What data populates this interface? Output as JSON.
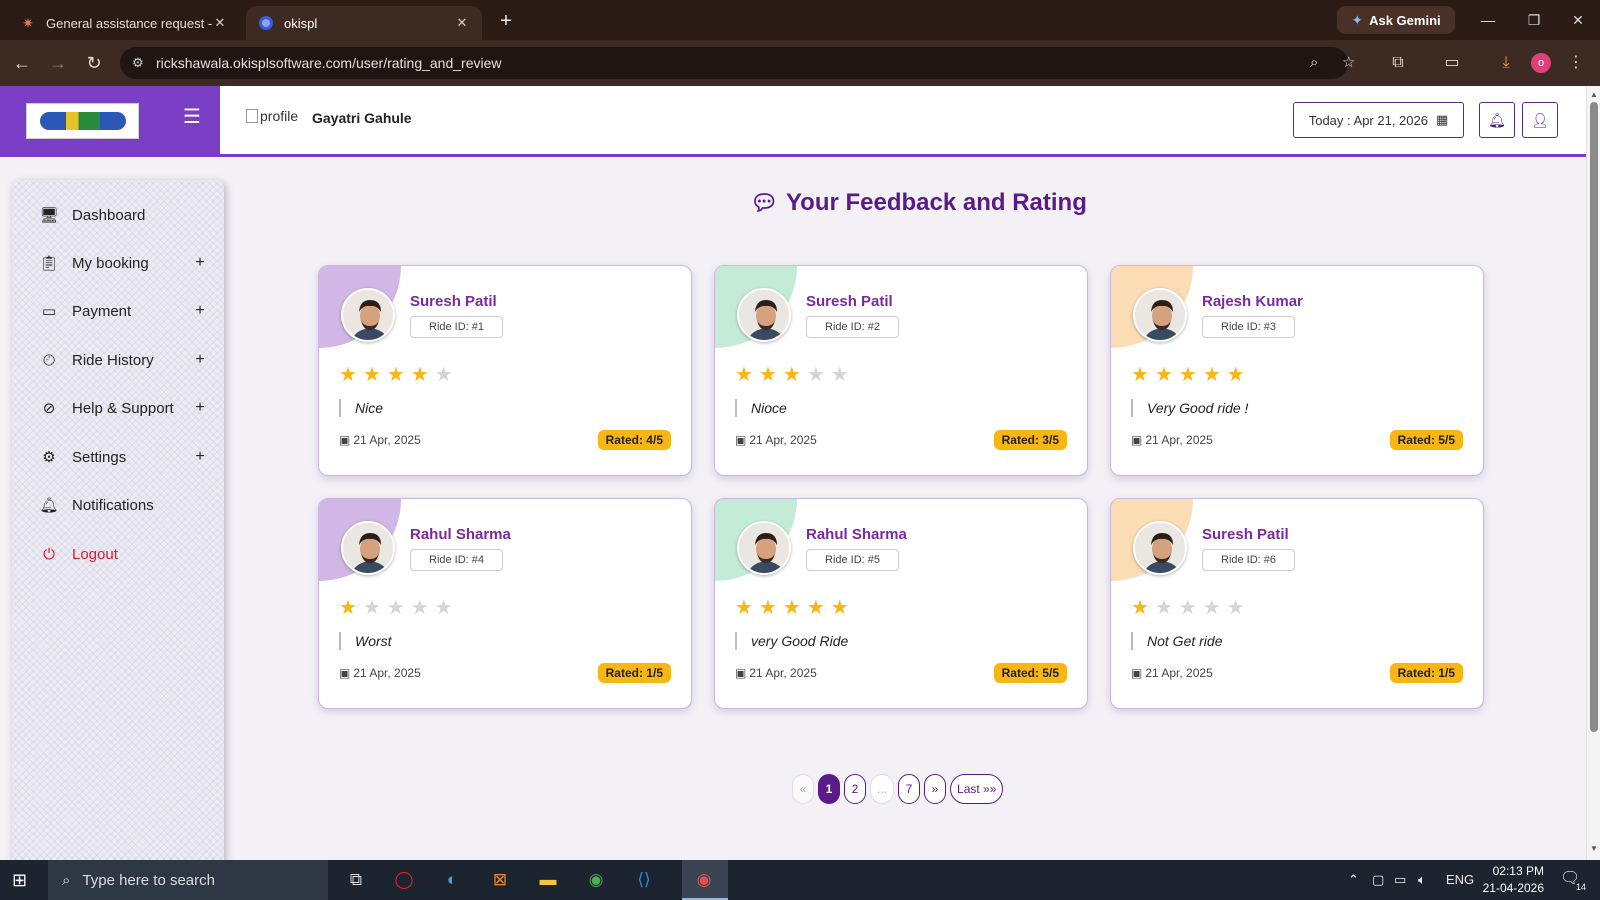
{
  "browser": {
    "tabs": [
      {
        "title": "General assistance request - Cla",
        "icon": "claude-star-icon"
      },
      {
        "title": "okispl",
        "icon": "globe-icon"
      }
    ],
    "gemini_label": "Ask Gemini",
    "url": "rickshawala.okisplsoftware.com/user/rating_and_review",
    "profile_initial": "o"
  },
  "header": {
    "profile_alt": "profile",
    "user_name": "Gayatri Gahule",
    "today_label": "Today : Apr 21, 2026"
  },
  "sidebar": {
    "items": [
      {
        "label": "Dashboard",
        "icon": "monitor-icon",
        "expandable": false
      },
      {
        "label": "My booking",
        "icon": "clipboard-icon",
        "expandable": true
      },
      {
        "label": "Payment",
        "icon": "credit-card-icon",
        "expandable": true
      },
      {
        "label": "Ride History",
        "icon": "clock-icon",
        "expandable": true
      },
      {
        "label": "Help & Support",
        "icon": "compass-icon",
        "expandable": true
      },
      {
        "label": "Settings",
        "icon": "gear-icon",
        "expandable": true
      },
      {
        "label": "Notifications",
        "icon": "bell-icon",
        "expandable": false
      },
      {
        "label": "Logout",
        "icon": "power-icon",
        "expandable": false
      }
    ],
    "plus_symbol": "+"
  },
  "main": {
    "title": "Your Feedback and Rating",
    "reviews": [
      {
        "name": "Suresh Patil",
        "ride_id": "Ride ID: #1",
        "stars": 4,
        "comment": "Nice",
        "date": "21 Apr, 2025",
        "rated": "Rated: 4/5",
        "accent": "#d2b6e6"
      },
      {
        "name": "Suresh Patil",
        "ride_id": "Ride ID: #2",
        "stars": 3,
        "comment": "Nioce",
        "date": "21 Apr, 2025",
        "rated": "Rated: 3/5",
        "accent": "#c4ebd6"
      },
      {
        "name": "Rajesh Kumar",
        "ride_id": "Ride ID: #3",
        "stars": 5,
        "comment": "Very Good ride !",
        "date": "21 Apr, 2025",
        "rated": "Rated: 5/5",
        "accent": "#fbdcb4"
      },
      {
        "name": "Rahul Sharma",
        "ride_id": "Ride ID: #4",
        "stars": 1,
        "comment": "Worst",
        "date": "21 Apr, 2025",
        "rated": "Rated: 1/5",
        "accent": "#d2b6e6"
      },
      {
        "name": "Rahul Sharma",
        "ride_id": "Ride ID: #5",
        "stars": 5,
        "comment": "very Good Ride",
        "date": "21 Apr, 2025",
        "rated": "Rated: 5/5",
        "accent": "#c4ebd6"
      },
      {
        "name": "Suresh Patil",
        "ride_id": "Ride ID: #6",
        "stars": 1,
        "comment": "Not Get ride",
        "date": "21 Apr, 2025",
        "rated": "Rated: 1/5",
        "accent": "#fbdcb4"
      }
    ],
    "pagination": {
      "prev": "«",
      "pages": [
        "1",
        "2",
        "...",
        "7"
      ],
      "current": "1",
      "next": "»",
      "last": "Last »»"
    }
  },
  "taskbar": {
    "search_placeholder": "Type here to search",
    "language": "ENG",
    "time": "02:13 PM",
    "date": "21-04-2026",
    "notification_count": "14"
  },
  "colors": {
    "brand": "#7a3fc4",
    "title": "#5a1a87",
    "star": "#f7b614",
    "logout": "#e0192a"
  }
}
